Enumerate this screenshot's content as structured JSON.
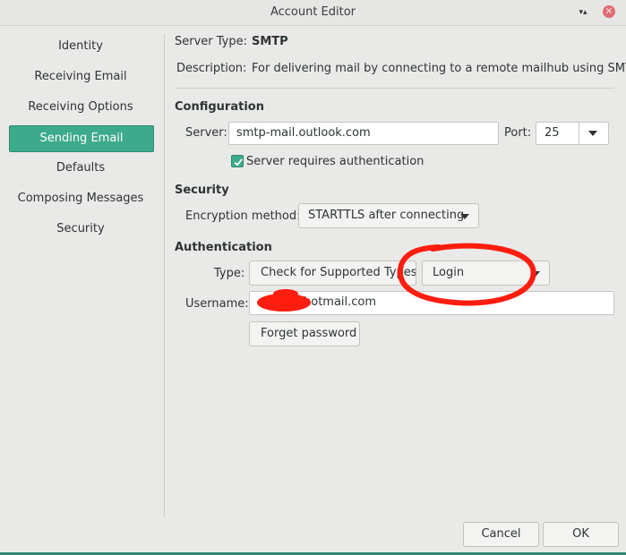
{
  "window": {
    "title": "Account Editor",
    "restore_glyph": "▾▴",
    "close_glyph": "×"
  },
  "sidebar": {
    "items": [
      {
        "label": "Identity"
      },
      {
        "label": "Receiving Email"
      },
      {
        "label": "Receiving Options"
      },
      {
        "label": "Sending Email"
      },
      {
        "label": "Defaults"
      },
      {
        "label": "Composing Messages"
      },
      {
        "label": "Security"
      }
    ]
  },
  "info": {
    "server_type_label": "Server Type:",
    "server_type_value": "SMTP",
    "description_label": "Description:",
    "description_value": "For delivering mail by connecting to a remote mailhub using SMTP."
  },
  "configuration": {
    "heading": "Configuration",
    "server_label": "Server:",
    "server_value": "smtp-mail.outlook.com",
    "port_label": "Port:",
    "port_value": "25",
    "requires_auth_label": "Server requires authentication",
    "requires_auth_checked": true
  },
  "security": {
    "heading": "Security",
    "encryption_label": "Encryption method:",
    "encryption_value": "STARTTLS after connecting"
  },
  "authentication": {
    "heading": "Authentication",
    "type_label": "Type:",
    "check_button": "Check for Supported Types",
    "type_value": "Login",
    "username_label": "Username:",
    "username_value": "@hotmail.com",
    "forget_button": "Forget password"
  },
  "footer": {
    "cancel": "Cancel",
    "ok": "OK"
  },
  "colors": {
    "accent": "#3daa8c",
    "annotation": "#ff1d10"
  }
}
